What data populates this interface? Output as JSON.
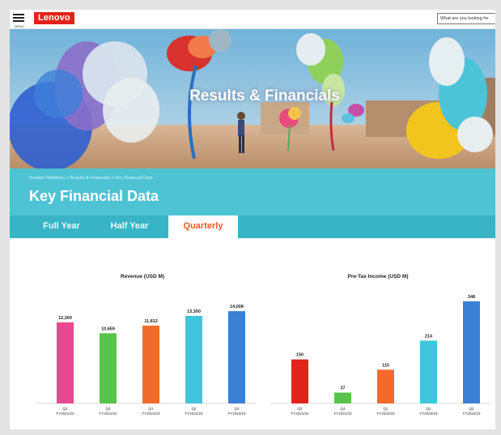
{
  "header": {
    "menu_caption": "MENU",
    "logo_text": "Lenovo",
    "search_placeholder": "What are you looking for"
  },
  "hero": {
    "title": "Results & Financials"
  },
  "section": {
    "breadcrumb": "Investor Relations  >  Results & Financials  >  Key Financial Data",
    "title": "Key Financial Data",
    "tabs": [
      {
        "label": "Full Year",
        "active": false
      },
      {
        "label": "Half Year",
        "active": false
      },
      {
        "label": "Quarterly",
        "active": true
      }
    ]
  },
  "colors": {
    "brand_red": "#e2231a",
    "teal": "#4dc3d3",
    "active_tab_text": "#f05a28"
  },
  "chart_data": [
    {
      "type": "bar",
      "title": "Revenue (USD M)",
      "categories": [
        [
          "Q2",
          "FY2021/22"
        ],
        [
          "Q4",
          "FY2021/22"
        ],
        [
          "Q1",
          "FY2022/23"
        ],
        [
          "Q2",
          "FY2022/23"
        ],
        [
          "Q3",
          "FY2022/23"
        ]
      ],
      "values": [
        12300,
        10659,
        11812,
        13300,
        14008
      ],
      "value_labels": [
        "12,300",
        "10,659",
        "11,812",
        "13,300",
        "14,008"
      ],
      "colors": [
        "#e8488f",
        "#56c44a",
        "#f26b2a",
        "#3fc6dc",
        "#3b7fd6"
      ],
      "ylim": [
        0,
        15500
      ]
    },
    {
      "type": "bar",
      "title": "Pre-Tax Income (USD M)",
      "categories": [
        [
          "Q2",
          "FY2021/22"
        ],
        [
          "Q4",
          "FY2021/22"
        ],
        [
          "Q1",
          "FY2022/23"
        ],
        [
          "Q2",
          "FY2022/23"
        ],
        [
          "Q3",
          "FY2022/23"
        ]
      ],
      "values": [
        150,
        37,
        115,
        214,
        348
      ],
      "value_labels": [
        "150",
        "37",
        "115",
        "214",
        "348"
      ],
      "colors": [
        "#e2231a",
        "#56c44a",
        "#f26b2a",
        "#3fc6dc",
        "#3b7fd6"
      ],
      "ylim": [
        0,
        348
      ]
    }
  ]
}
